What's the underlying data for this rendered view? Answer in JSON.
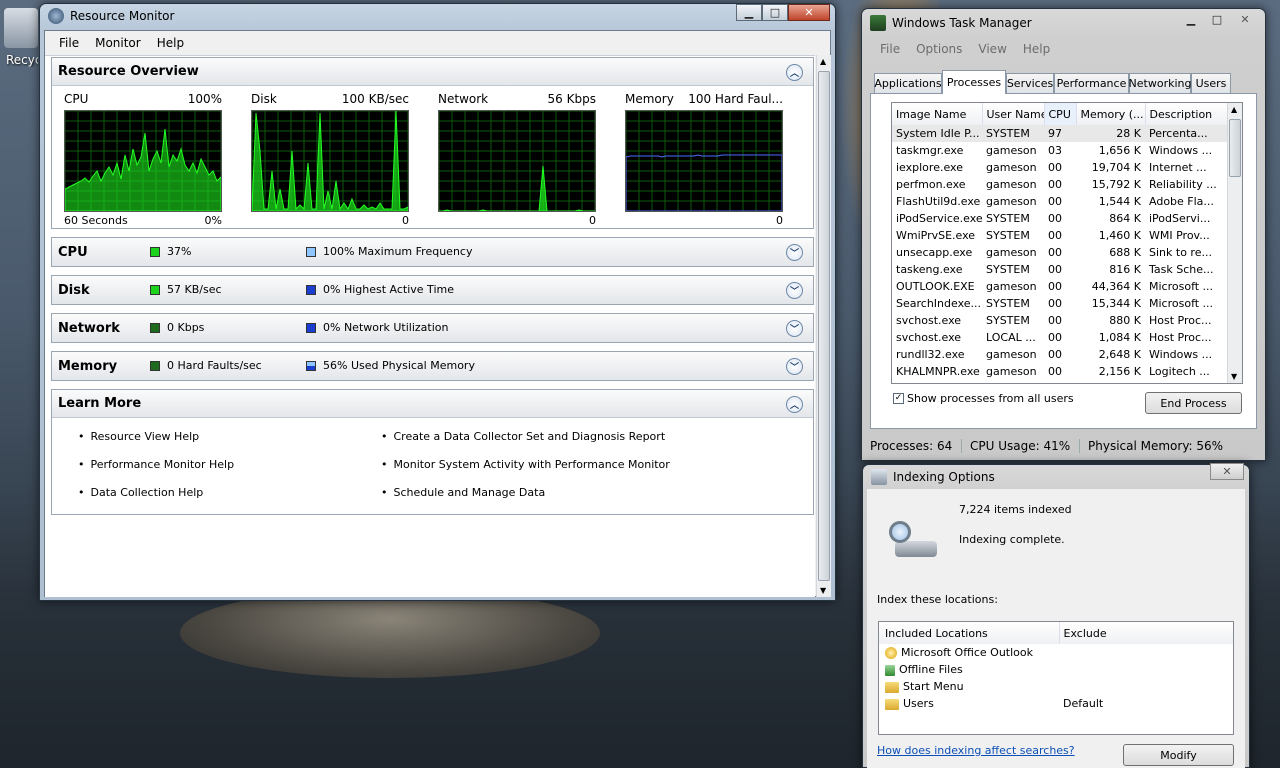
{
  "desktop": {
    "recycle_label": "Recycle Bin"
  },
  "resource_monitor": {
    "title": "Resource Monitor",
    "menu": [
      "File",
      "Monitor",
      "Help"
    ],
    "overview": {
      "heading": "Resource Overview",
      "graphs": [
        {
          "name": "CPU",
          "max": "100%",
          "bottom_left": "60 Seconds",
          "bottom_right": "0%"
        },
        {
          "name": "Disk",
          "max": "100 KB/sec",
          "bottom_left": "",
          "bottom_right": "0"
        },
        {
          "name": "Network",
          "max": "56 Kbps",
          "bottom_left": "",
          "bottom_right": "0"
        },
        {
          "name": "Memory",
          "max": "100 Hard Faul...",
          "bottom_left": "",
          "bottom_right": "0"
        }
      ]
    },
    "cpu": {
      "heading": "CPU",
      "value": "37%",
      "detail": "100% Maximum Frequency"
    },
    "disk": {
      "heading": "Disk",
      "value": "57 KB/sec",
      "detail": "0% Highest Active Time"
    },
    "network": {
      "heading": "Network",
      "value": "0 Kbps",
      "detail": "0% Network Utilization"
    },
    "memory": {
      "heading": "Memory",
      "value": "0 Hard Faults/sec",
      "detail": "56% Used Physical Memory"
    },
    "learn_more": {
      "heading": "Learn More",
      "left": [
        "Resource View Help",
        "Performance Monitor Help",
        "Data Collection Help"
      ],
      "right": [
        "Create a Data Collector Set and Diagnosis Report",
        "Monitor System Activity with Performance Monitor",
        "Schedule and Manage Data"
      ]
    }
  },
  "task_manager": {
    "title": "Windows Task Manager",
    "menu": [
      "File",
      "Options",
      "View",
      "Help"
    ],
    "tabs": [
      "Applications",
      "Processes",
      "Services",
      "Performance",
      "Networking",
      "Users"
    ],
    "columns": [
      "Image Name",
      "User Name",
      "CPU",
      "Memory (...",
      "Description"
    ],
    "rows": [
      [
        "System Idle P...",
        "SYSTEM",
        "97",
        "28 K",
        "Percenta..."
      ],
      [
        "taskmgr.exe",
        "gameson",
        "03",
        "1,656 K",
        "Windows ..."
      ],
      [
        "iexplore.exe",
        "gameson",
        "00",
        "19,704 K",
        "Internet ..."
      ],
      [
        "perfmon.exe",
        "gameson",
        "00",
        "15,792 K",
        "Reliability ..."
      ],
      [
        "FlashUtil9d.exe",
        "gameson",
        "00",
        "1,544 K",
        "Adobe Fla..."
      ],
      [
        "iPodService.exe",
        "SYSTEM",
        "00",
        "864 K",
        "iPodServi..."
      ],
      [
        "WmiPrvSE.exe",
        "SYSTEM",
        "00",
        "1,460 K",
        "WMI Prov..."
      ],
      [
        "unsecapp.exe",
        "gameson",
        "00",
        "688 K",
        "Sink to re..."
      ],
      [
        "taskeng.exe",
        "SYSTEM",
        "00",
        "816 K",
        "Task Sche..."
      ],
      [
        "OUTLOOK.EXE",
        "gameson",
        "00",
        "44,364 K",
        "Microsoft ..."
      ],
      [
        "SearchIndexe...",
        "SYSTEM",
        "00",
        "15,344 K",
        "Microsoft ..."
      ],
      [
        "svchost.exe",
        "SYSTEM",
        "00",
        "880 K",
        "Host Proc..."
      ],
      [
        "svchost.exe",
        "LOCAL ...",
        "00",
        "1,084 K",
        "Host Proc..."
      ],
      [
        "rundll32.exe",
        "gameson",
        "00",
        "2,648 K",
        "Windows ..."
      ],
      [
        "KHALMNPR.exe",
        "gameson",
        "00",
        "2,156 K",
        "Logitech ..."
      ]
    ],
    "show_all_label": "Show processes from all users",
    "end_process_label": "End Process",
    "status": {
      "processes": "Processes: 64",
      "cpu": "CPU Usage: 41%",
      "memory": "Physical Memory: 56%"
    }
  },
  "indexing": {
    "title": "Indexing Options",
    "items_indexed": "7,224 items indexed",
    "state": "Indexing complete.",
    "locations_label": "Index these locations:",
    "col_included": "Included Locations",
    "col_exclude": "Exclude",
    "locations": [
      {
        "name": "Microsoft Office Outlook",
        "exclude": ""
      },
      {
        "name": "Offline Files",
        "exclude": ""
      },
      {
        "name": "Start Menu",
        "exclude": ""
      },
      {
        "name": "Users",
        "exclude": "Default"
      }
    ],
    "help_link": "How does indexing affect searches?",
    "modify_label": "Modify"
  },
  "colors": {
    "graph_green": "#1bd41b",
    "graph_blue": "#4a6cff",
    "accent_blue": "#1a3fd0"
  }
}
